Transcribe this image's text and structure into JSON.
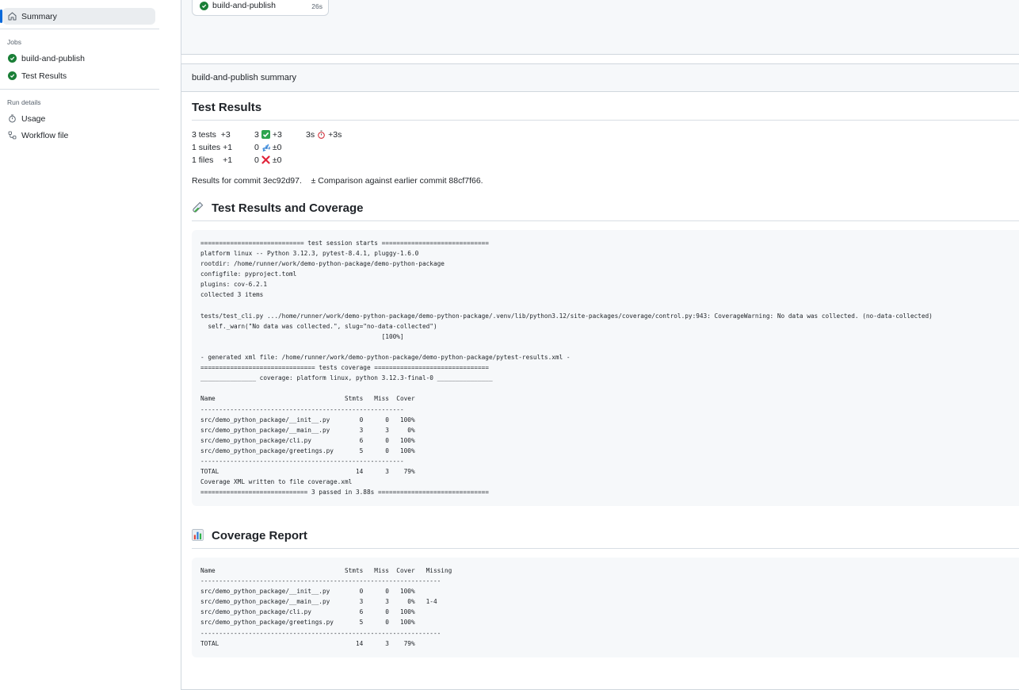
{
  "sidebar": {
    "summary_label": "Summary",
    "jobs_heading": "Jobs",
    "jobs": [
      {
        "label": "build-and-publish",
        "status": "success"
      },
      {
        "label": "Test Results",
        "status": "success"
      }
    ],
    "run_details_heading": "Run details",
    "run_details": [
      {
        "label": "Usage",
        "icon": "stopwatch-icon"
      },
      {
        "label": "Workflow file",
        "icon": "workflow-icon"
      }
    ]
  },
  "job_card": {
    "name": "build-and-publish",
    "duration": "26s"
  },
  "summary": {
    "header": "build-and-publish summary",
    "test_results_title": "Test Results",
    "stats": {
      "row1": {
        "tests": "3 tests",
        "tests_delta": "+3",
        "passed": "3",
        "passed_delta": "+3",
        "time": "3s",
        "time_delta": "+3s"
      },
      "row2": {
        "suites": "1 suites",
        "suites_delta": "+1",
        "skipped": "0",
        "skipped_delta": "±0"
      },
      "row3": {
        "files": "1 files",
        "files_delta": "+1",
        "failed": "0",
        "failed_delta": "±0"
      }
    },
    "commit_text": "Results for commit 3ec92d97.",
    "comparison_text": "± Comparison against earlier commit 88cf7f66.",
    "coverage_section_title": "Test Results and Coverage",
    "coverage_report_title": "Coverage Report",
    "pytest_output": "============================ test session starts =============================\nplatform linux -- Python 3.12.3, pytest-8.4.1, pluggy-1.6.0\nrootdir: /home/runner/work/demo-python-package/demo-python-package\nconfigfile: pyproject.toml\nplugins: cov-6.2.1\ncollected 3 items\n\ntests/test_cli.py .../home/runner/work/demo-python-package/demo-python-package/.venv/lib/python3.12/site-packages/coverage/control.py:943: CoverageWarning: No data was collected. (no-data-collected)\n  self._warn(\"No data was collected.\", slug=\"no-data-collected\")\n                                                 [100%]\n\n- generated xml file: /home/runner/work/demo-python-package/demo-python-package/pytest-results.xml -\n=============================== tests coverage ===============================\n_______________ coverage: platform linux, python 3.12.3-final-0 _______________\n\nName                                   Stmts   Miss  Cover\n-------------------------------------------------------\nsrc/demo_python_package/__init__.py        0      0   100%\nsrc/demo_python_package/__main__.py        3      3     0%\nsrc/demo_python_package/cli.py             6      0   100%\nsrc/demo_python_package/greetings.py       5      0   100%\n-------------------------------------------------------\nTOTAL                                     14      3    79%\nCoverage XML written to file coverage.xml\n============================= 3 passed in 3.88s ==============================",
    "coverage_table": "Name                                   Stmts   Miss  Cover   Missing\n-----------------------------------------------------------------\nsrc/demo_python_package/__init__.py        0      0   100%\nsrc/demo_python_package/__main__.py        3      3     0%   1-4\nsrc/demo_python_package/cli.py             6      0   100%\nsrc/demo_python_package/greetings.py       5      0   100%\n-----------------------------------------------------------------\nTOTAL                                     14      3    79%"
  },
  "colors": {
    "success": "#1a7f37",
    "accent": "#0969da",
    "fail": "#cf222e"
  }
}
